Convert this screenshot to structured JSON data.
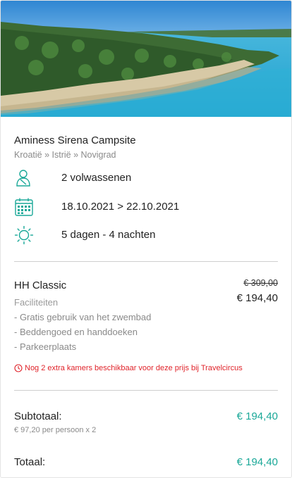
{
  "colors": {
    "accent": "#1aa898",
    "warning": "#e0232a",
    "muted": "#8a8a8a"
  },
  "property": {
    "name": "Aminess Sirena Campsite",
    "location": "Kroatië » Istrië » Novigrad"
  },
  "details": {
    "guests": {
      "icon": "person-icon",
      "text": "2 volwassenen"
    },
    "dates": {
      "icon": "calendar-icon",
      "text": "18.10.2021 > 22.10.2021"
    },
    "duration": {
      "icon": "sun-icon",
      "text": "5 dagen - 4 nachten"
    }
  },
  "room": {
    "name": "HH Classic",
    "price_old": "€ 309,00",
    "price_new": "€ 194,40",
    "facilities_heading": "Faciliteiten",
    "facilities": [
      "- Gratis gebruik van het zwembad",
      "- Beddengoed en handdoeken",
      "- Parkeerplaats"
    ],
    "availability": {
      "icon": "clock-icon",
      "text": "Nog 2 extra kamers beschikbaar voor deze prijs bij Travelcircus"
    }
  },
  "summary": {
    "subtotal_label": "Subtotaal:",
    "subtotal_value": "€ 194,40",
    "subtotal_note": "€ 97,20 per persoon x 2",
    "total_label": "Totaal:",
    "total_value": "€ 194,40"
  }
}
